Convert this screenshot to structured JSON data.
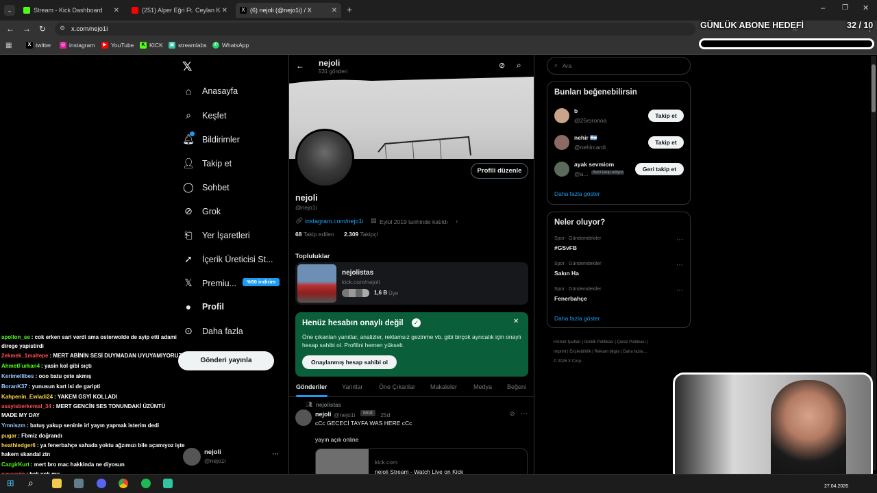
{
  "browser": {
    "tabs": [
      {
        "title": "Stream - Kick Dashboard",
        "color": "#53fc18"
      },
      {
        "title": "(251) Alper Eğri Ft. Ceylan Koyn",
        "color": "#ff0000"
      },
      {
        "title": "(6) nejoli (@nejo1i) / X",
        "color": "#ffffff"
      }
    ],
    "url": "x.com/nejo1i",
    "bookmarks": [
      "twitter",
      "instagram",
      "YouTube",
      "KICK",
      "streamlabs",
      "WhatsApp"
    ]
  },
  "overlay": {
    "goal_title": "GÜNLÜK ABONE HEDEFİ",
    "goal_count": "32 / 10"
  },
  "nav": {
    "items": [
      "Anasayfa",
      "Keşfet",
      "Bildirimler",
      "Takip et",
      "Sohbet",
      "Grok",
      "Yer İşaretleri",
      "İçerik Üreticisi St...",
      "Premiu...",
      "Profil",
      "Daha fazla"
    ],
    "premium_badge": "%50 indirim",
    "post_button": "Gönderi yayınla",
    "account_name": "nejoli",
    "account_handle": "@nejo1i"
  },
  "profile": {
    "header_name": "nejoli",
    "header_posts": "531 gönderi",
    "edit_button": "Profili düzenle",
    "name": "nejoli",
    "handle": "@nejo1i",
    "link": "instagram.com/nejo1i",
    "joined": "Eylül 2019 tarihinde katıldı",
    "following_count": "68",
    "following_label": "Takip edilen",
    "followers_count": "2.309",
    "followers_label": "Takipçi",
    "communities_title": "Topluluklar",
    "community_name": "nejolistas",
    "community_url": "kick.com/nejoli",
    "community_members": "1,6 B",
    "community_members_label": "Üye",
    "verify_title": "Henüz hesabın onaylı değil",
    "verify_text": "Öne çıkanlan yanıtlar, analizler, reklamsız gezinme vb. gibi birçok ayrıcalık için onaylı hesap sahibi ol. Profilini hemen yükselt.",
    "verify_button": "Onaylanmış hesap sahibi ol",
    "tabs": [
      "Gönderiler",
      "Yanıtlar",
      "Öne Çıkanlar",
      "Makaleler",
      "Medya",
      "Beğeni"
    ],
    "post": {
      "community": "nejolistas",
      "name": "nejoli",
      "handle": "@nejo1i",
      "badge": "Mod",
      "time": "· 25d",
      "line1": "cCc GECECİ TAYFA WAS HERE cCc",
      "line2": "yayın açık online",
      "card_domain": "kick.com",
      "card_title": "nejoli Stream - Watch Live on Kick"
    }
  },
  "right": {
    "search_placeholder": "Ara",
    "suggest_title": "Bunları beğenebilirsin",
    "suggestions": [
      {
        "name": "b",
        "handle": "@25roronoa",
        "button": "Takip et"
      },
      {
        "name": "nehir 🇦🇷",
        "handle": "@nehircardi",
        "button": "Takip et"
      },
      {
        "name": "ayak sevmiom",
        "handle": "@a...",
        "note": "Seni takip ediyor",
        "button": "Geri takip et"
      }
    ],
    "show_more": "Daha fazla göster",
    "trends_title": "Neler oluyor?",
    "trends": [
      {
        "category": "Spor · Gündemdekiler",
        "name": "#GSvFB"
      },
      {
        "category": "Spor · Gündemdekiler",
        "name": "Sakın Ha"
      },
      {
        "category": "Spor · Gündemdekiler",
        "name": "Fenerbahçe"
      }
    ],
    "show_more_2": "Daha fazla göster",
    "footer": [
      "Hizmet Şartları",
      "Gizlilik Politikası",
      "Çerez Politikası",
      "Imprint",
      "Erişilebilirlik",
      "Reklam bilgisi",
      "Daha fazla ...",
      "© 2026 X Corp."
    ]
  },
  "chat": [
    {
      "user": "apollon_se",
      "color": "#4fc3f7",
      "msg": ": cok erken sari verdi ama osterwolde de ayip etti adami"
    },
    {
      "user": "",
      "color": "#ffffff",
      "msg": "direge yapistirdi"
    },
    {
      "user": "2ekmek_1maltepe",
      "color": "#ff4f4f",
      "msg": ": MERT ABİNİN SESİ DUYMADAN UYUYAMIYORUZ"
    },
    {
      "user": "AhmetFurkan4",
      "color": "#53fc18",
      "msg": ": yasin kol gibi sıçtı"
    },
    {
      "user": "Kerimellibes",
      "color": "#9ecbff",
      "msg": ": ooo batu çete akmış"
    },
    {
      "user": "BoranK37",
      "color": "#9ecbff",
      "msg": ": yunusun kart isi de garipti"
    },
    {
      "user": "Kahpenin_Ewladi24",
      "color": "#ffd54f",
      "msg": ": YAKEM GSYİ KOLLADI"
    },
    {
      "user": "asayisberkemal_34",
      "color": "#ff4f4f",
      "msg": ": MERT GENCİN SES TONUNDAKİ ÜZÜNTÜ"
    },
    {
      "user": "",
      "color": "#ffffff",
      "msg": "MADE MY DAY"
    },
    {
      "user": "Ymniszm",
      "color": "#9ecbff",
      "msg": ": batuş yakup seninle irl yayın yapmak isterim dedi"
    },
    {
      "user": "pugar",
      "color": "#ffd54f",
      "msg": ": Fbmiz doğrandı"
    },
    {
      "user": "heathledger6",
      "color": "#ffd54f",
      "msg": ": ya fenerbahçe sahada yoktu ağzımızı bile açamıyoz işte"
    },
    {
      "user": "",
      "color": "#ffffff",
      "msg": "hakem skandal ztn"
    },
    {
      "user": "CazgirKurt",
      "color": "#53fc18",
      "msg": ": mert bro mac hakkinda ne diyosun"
    },
    {
      "user": "ayusovic",
      "color": "#ff4f4f",
      "msg": ": bak yok mu"
    }
  ],
  "taskbar": {
    "date": "27.04.2026"
  }
}
